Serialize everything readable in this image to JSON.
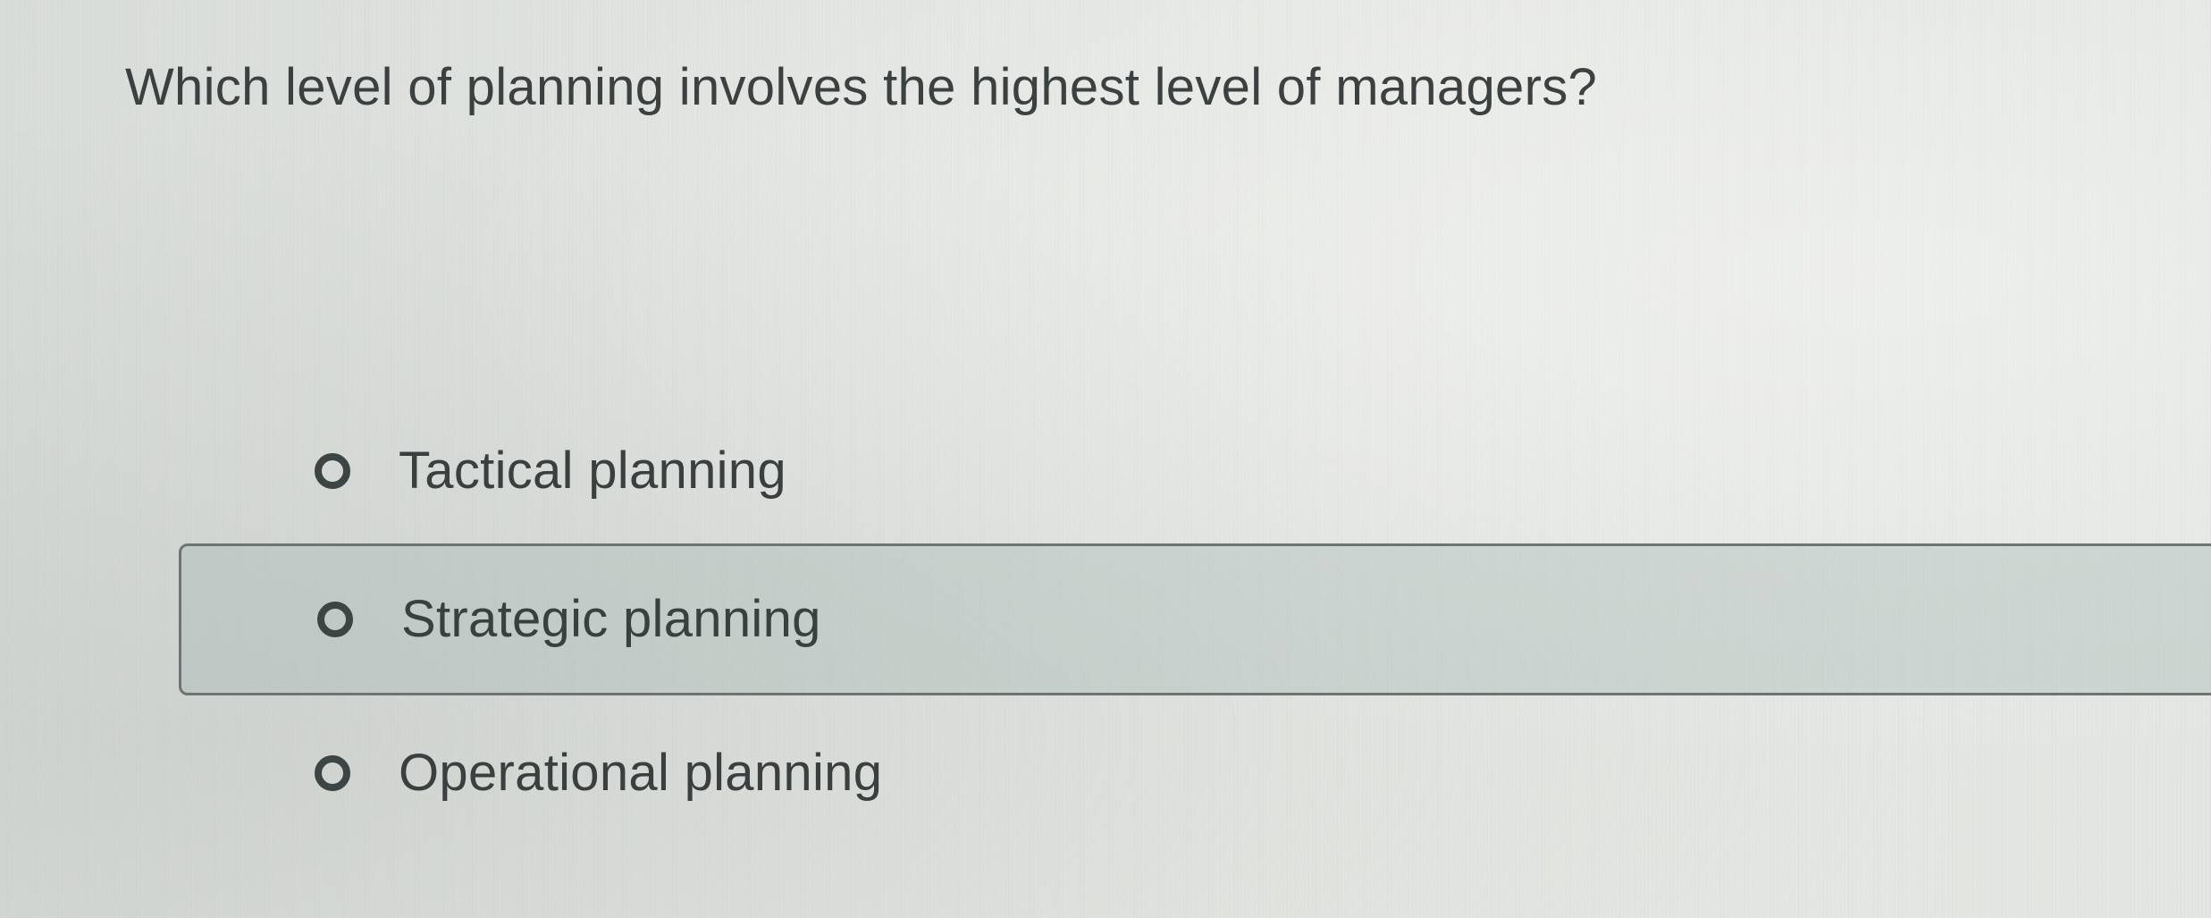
{
  "question": {
    "text": "Which level of planning involves the highest level of managers?"
  },
  "options": [
    {
      "label": "Tactical planning",
      "icon": "radio-unchecked-icon"
    },
    {
      "label": "Strategic planning",
      "icon": "radio-unchecked-icon",
      "highlighted": true
    },
    {
      "label": "Operational planning",
      "icon": "radio-unchecked-icon"
    }
  ],
  "colors": {
    "text": "#3a4040",
    "highlight_background": "#b6c2bf",
    "highlight_border": "#6d7574",
    "page_background": "#e2e5e1"
  }
}
